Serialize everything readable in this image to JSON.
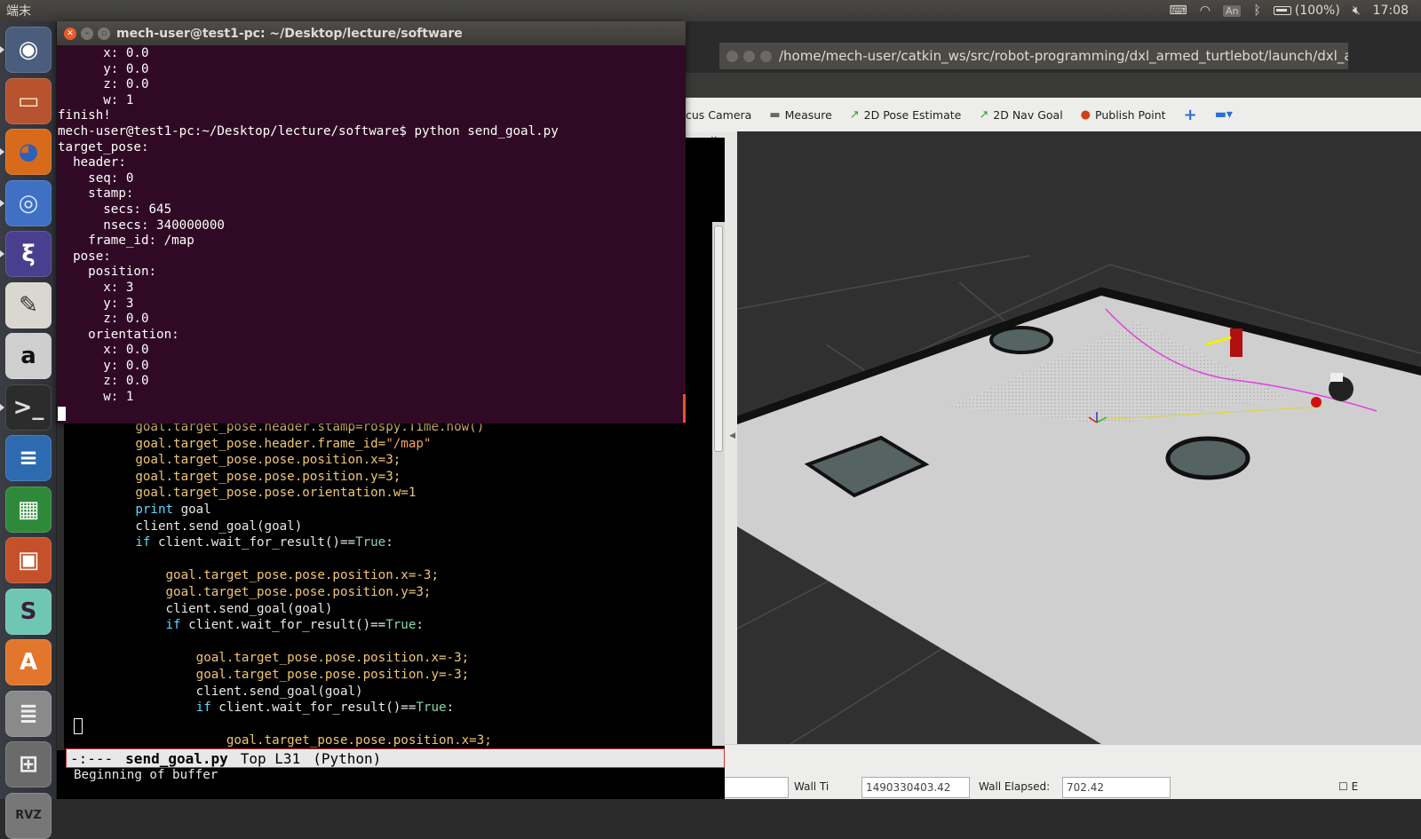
{
  "top_panel": {
    "app_name": "端末",
    "keyboard_badge": "An",
    "battery_text": "(100%)",
    "clock": "17:08"
  },
  "launcher": {
    "items": [
      {
        "name": "ubuntu-dash",
        "glyph": "◉",
        "bg": "#4a5d7c",
        "fg": "#ffffff"
      },
      {
        "name": "files",
        "glyph": "▭",
        "bg": "#b7532e",
        "fg": "#f4e6d0"
      },
      {
        "name": "firefox",
        "glyph": "◕",
        "bg": "#d86a1c",
        "fg": "#2b62b8"
      },
      {
        "name": "chromium",
        "glyph": "◎",
        "bg": "#3f70c4",
        "fg": "#dce8ff"
      },
      {
        "name": "emacs",
        "glyph": "ξ",
        "bg": "#4a3f8f",
        "fg": "#ffffff"
      },
      {
        "name": "text-editor",
        "glyph": "✎",
        "bg": "#d9d7cf",
        "fg": "#333"
      },
      {
        "name": "amazon",
        "glyph": "a",
        "bg": "#cfcfcf",
        "fg": "#111"
      },
      {
        "name": "terminal",
        "glyph": ">_",
        "bg": "#2c2c2c",
        "fg": "#ddd"
      },
      {
        "name": "libreoffice-writer",
        "glyph": "≡",
        "bg": "#2e6ab0",
        "fg": "#fff"
      },
      {
        "name": "libreoffice-calc",
        "glyph": "▦",
        "bg": "#2e8a3a",
        "fg": "#fff"
      },
      {
        "name": "libreoffice-impress",
        "glyph": "▣",
        "bg": "#c4512a",
        "fg": "#fff"
      },
      {
        "name": "slack",
        "glyph": "S",
        "bg": "#6fc6b3",
        "fg": "#3b1f3b"
      },
      {
        "name": "software-center",
        "glyph": "A",
        "bg": "#e2762d",
        "fg": "#fff"
      },
      {
        "name": "system-settings",
        "glyph": "≣",
        "bg": "#8a8a8a",
        "fg": "#eee"
      },
      {
        "name": "workspaces",
        "glyph": "⊞",
        "bg": "#6b6b6b",
        "fg": "#eee"
      },
      {
        "name": "rviz",
        "glyph": "RVZ",
        "bg": "#777",
        "fg": "#222"
      }
    ]
  },
  "terminal": {
    "title": "mech-user@test1-pc: ~/Desktop/lecture/software",
    "lines": [
      "      x: 0.0",
      "      y: 0.0",
      "      z: 0.0",
      "      w: 1",
      "finish!",
      "mech-user@test1-pc:~/Desktop/lecture/software$ python send_goal.py",
      "target_pose:",
      "  header:",
      "    seq: 0",
      "    stamp:",
      "      secs: 645",
      "      nsecs: 340000000",
      "    frame_id: /map",
      "  pose:",
      "    position:",
      "      x: 3",
      "      y: 3",
      "      z: 0.0",
      "    orientation:",
      "      x: 0.0",
      "      y: 0.0",
      "      z: 0.0",
      "      w: 1"
    ]
  },
  "emacs": {
    "code_lines": [
      {
        "indent": "        ",
        "parts": [
          [
            "",
            "goal.target_pose.header.stamp=rospy.Time.now()"
          ]
        ]
      },
      {
        "indent": "        ",
        "parts": [
          [
            "",
            "goal.target_pose.header.frame_id="
          ],
          [
            "str",
            "\"/map\""
          ]
        ]
      },
      {
        "indent": "        ",
        "parts": [
          [
            "",
            "goal.target_pose.pose.position.x=3;"
          ]
        ]
      },
      {
        "indent": "        ",
        "parts": [
          [
            "",
            "goal.target_pose.pose.position.y=3;"
          ]
        ]
      },
      {
        "indent": "        ",
        "parts": [
          [
            "",
            "goal.target_pose.pose.orientation.w=1"
          ]
        ]
      },
      {
        "indent": "        ",
        "parts": [
          [
            "kw",
            "print"
          ],
          [
            "plain",
            " goal"
          ]
        ]
      },
      {
        "indent": "        ",
        "parts": [
          [
            "plain",
            "client.send_goal(goal)"
          ]
        ]
      },
      {
        "indent": "        ",
        "parts": [
          [
            "kw",
            "if"
          ],
          [
            "plain",
            " client.wait_for_result()=="
          ],
          [
            "bool",
            "True"
          ],
          [
            "plain",
            ":"
          ]
        ]
      },
      {
        "indent": "",
        "parts": [
          [
            "plain",
            ""
          ]
        ]
      },
      {
        "indent": "            ",
        "parts": [
          [
            "",
            "goal.target_pose.pose.position.x=-3;"
          ]
        ]
      },
      {
        "indent": "            ",
        "parts": [
          [
            "",
            "goal.target_pose.pose.position.y=3;"
          ]
        ]
      },
      {
        "indent": "            ",
        "parts": [
          [
            "plain",
            "client.send_goal(goal)"
          ]
        ]
      },
      {
        "indent": "            ",
        "parts": [
          [
            "kw",
            "if"
          ],
          [
            "plain",
            " client.wait_for_result()=="
          ],
          [
            "bool",
            "True"
          ],
          [
            "plain",
            ":"
          ]
        ]
      },
      {
        "indent": "",
        "parts": [
          [
            "plain",
            ""
          ]
        ]
      },
      {
        "indent": "                ",
        "parts": [
          [
            "",
            "goal.target_pose.pose.position.x=-3;"
          ]
        ]
      },
      {
        "indent": "                ",
        "parts": [
          [
            "",
            "goal.target_pose.pose.position.y=-3;"
          ]
        ]
      },
      {
        "indent": "                ",
        "parts": [
          [
            "plain",
            "client.send_goal(goal)"
          ]
        ]
      },
      {
        "indent": "                ",
        "parts": [
          [
            "kw",
            "if"
          ],
          [
            "plain",
            " client.wait_for_result()=="
          ],
          [
            "bool",
            "True"
          ],
          [
            "plain",
            ":"
          ]
        ]
      },
      {
        "indent": "",
        "parts": [
          [
            "plain",
            ""
          ]
        ]
      },
      {
        "indent": "                    ",
        "parts": [
          [
            "",
            "goal.target_pose.pose.position.x=3;"
          ]
        ]
      }
    ],
    "modeline": {
      "status": "-:---",
      "buffer_name": "send_goal.py",
      "position": "Top L31",
      "mode": "(Python)"
    },
    "echo_area": "Beginning of buffer"
  },
  "rviz": {
    "window_title": "/home/mech-user/catkin_ws/src/robot-programming/dxl_armed_turtlebot/launch/dxl_arm",
    "tools": [
      {
        "label": "cus Camera",
        "icon": "focus-camera-icon",
        "glyph": ""
      },
      {
        "label": "Measure",
        "icon": "measure-icon",
        "glyph": "▬"
      },
      {
        "label": "2D Pose Estimate",
        "icon": "pose-estimate-icon",
        "glyph": "↗"
      },
      {
        "label": "2D Nav Goal",
        "icon": "nav-goal-icon",
        "glyph": "↗"
      },
      {
        "label": "Publish Point",
        "icon": "publish-point-icon",
        "glyph": "●"
      }
    ],
    "bottom_fields": [
      {
        "label": "Wall Ti",
        "value": "1490330403.42"
      },
      {
        "label": "Wall Elapsed:",
        "value": "702.42"
      }
    ]
  }
}
